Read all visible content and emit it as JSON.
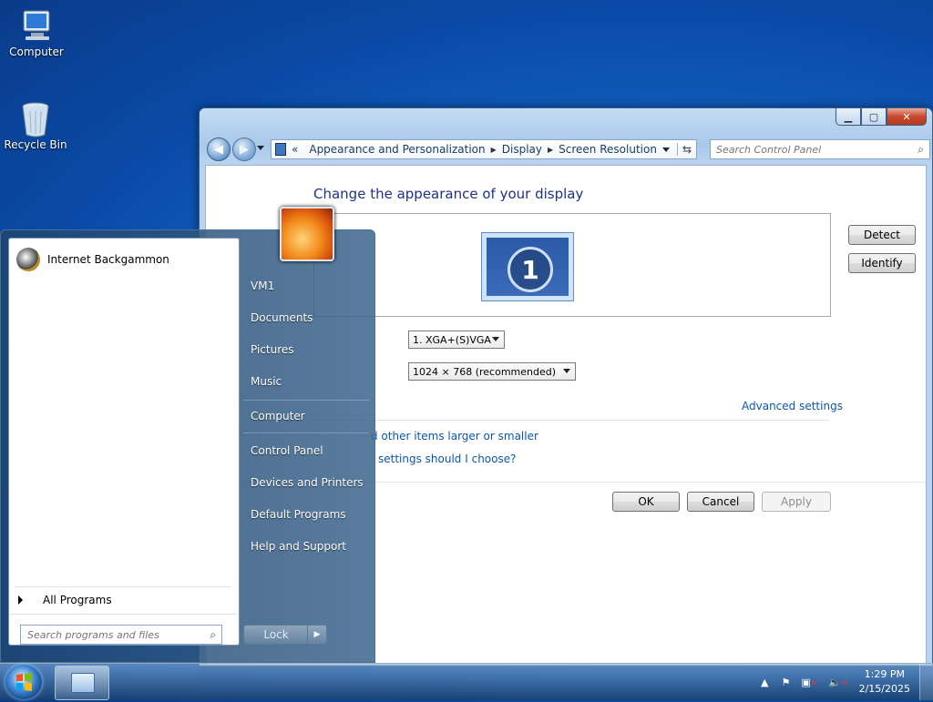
{
  "desktop": {
    "icons": [
      {
        "label": "Computer"
      },
      {
        "label": "Recycle Bin"
      }
    ]
  },
  "window": {
    "address": {
      "prefix": "«",
      "crumbs": [
        "Appearance and Personalization",
        "Display",
        "Screen Resolution"
      ]
    },
    "search_placeholder": "Search Control Panel",
    "heading": "Change the appearance of your display",
    "buttons": {
      "detect": "Detect",
      "identify": "Identify",
      "ok": "OK",
      "cancel": "Cancel",
      "apply": "Apply"
    },
    "monitor_number": "1",
    "display_value": "1. XGA+(S)VGA",
    "resolution_value": "1024 × 768 (recommended)",
    "advanced_link": "Advanced settings",
    "link_larger": "d other items larger or smaller",
    "link_settings": "settings should I choose?"
  },
  "start_menu": {
    "programs": [
      {
        "label": "Internet Backgammon"
      }
    ],
    "all_programs": "All Programs",
    "search_placeholder": "Search programs and files",
    "right_items": [
      "VM1",
      "Documents",
      "Pictures",
      "Music",
      "Computer",
      "Control Panel",
      "Devices and Printers",
      "Default Programs",
      "Help and Support"
    ],
    "lock_label": "Lock"
  },
  "taskbar": {
    "time": "1:29 PM",
    "date": "2/15/2025"
  }
}
